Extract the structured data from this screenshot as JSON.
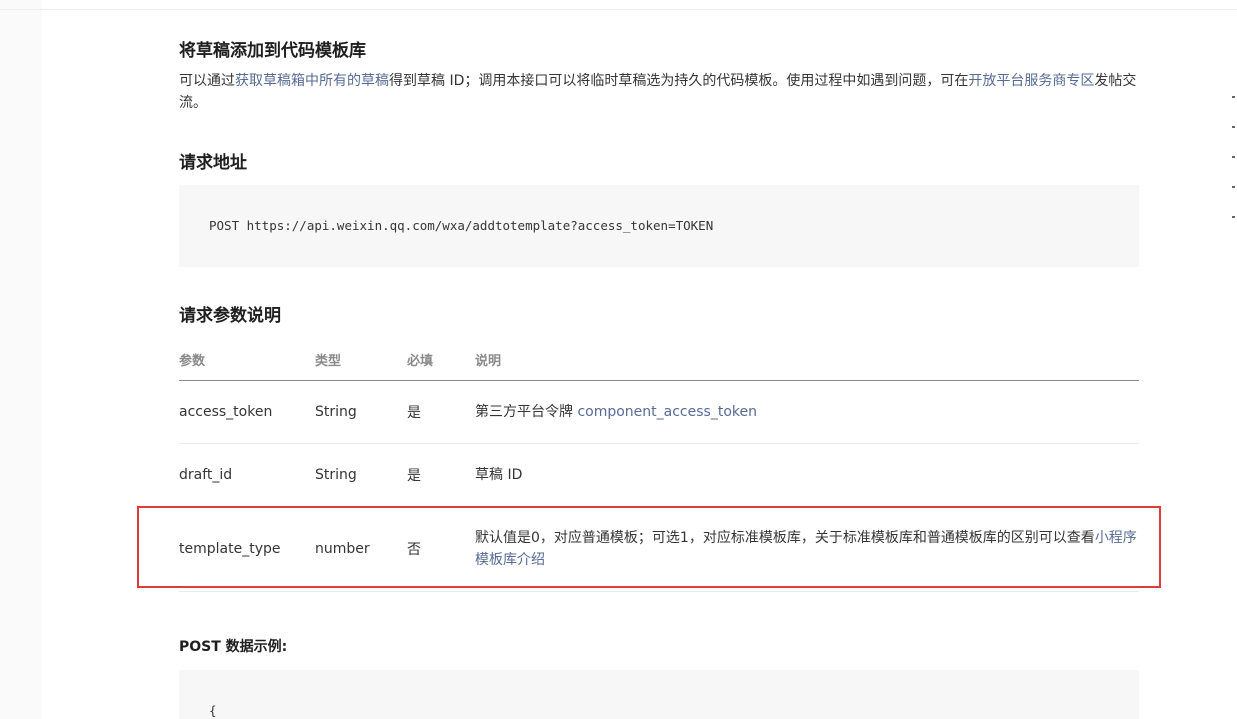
{
  "title": "将草稿添加到代码模板库",
  "intro": {
    "t1": "可以通过",
    "link1": "获取草稿箱中所有的草稿",
    "t2": "得到草稿 ID；调用本接口可以将临时草稿选为持久的代码模板。使用过程中如遇到问题，可在",
    "link2": "开放平台服务商专区",
    "t3": "发帖交流。"
  },
  "request_url": {
    "heading": "请求地址",
    "code": "POST https://api.weixin.qq.com/wxa/addtotemplate?access_token=TOKEN"
  },
  "params": {
    "heading": "请求参数说明",
    "headers": [
      "参数",
      "类型",
      "必填",
      "说明"
    ],
    "rows": [
      {
        "name": "access_token",
        "type": "String",
        "required": "是",
        "desc_text": "第三方平台令牌 ",
        "desc_link": "component_access_token"
      },
      {
        "name": "draft_id",
        "type": "String",
        "required": "是",
        "desc_text": "草稿 ID",
        "desc_link": ""
      },
      {
        "name": "template_type",
        "type": "number",
        "required": "否",
        "desc_text": "默认值是0，对应普通模板；可选1，对应标准模板库，关于标准模板库和普通模板库的区别可以查看",
        "desc_link": "小程序模板库介绍"
      }
    ]
  },
  "post_example": {
    "heading": "POST 数据示例:",
    "code_first_line": "{"
  },
  "colors": {
    "link": "#576b95",
    "highlight_border": "#e03c3c",
    "code_bg": "#f7f7f7"
  }
}
